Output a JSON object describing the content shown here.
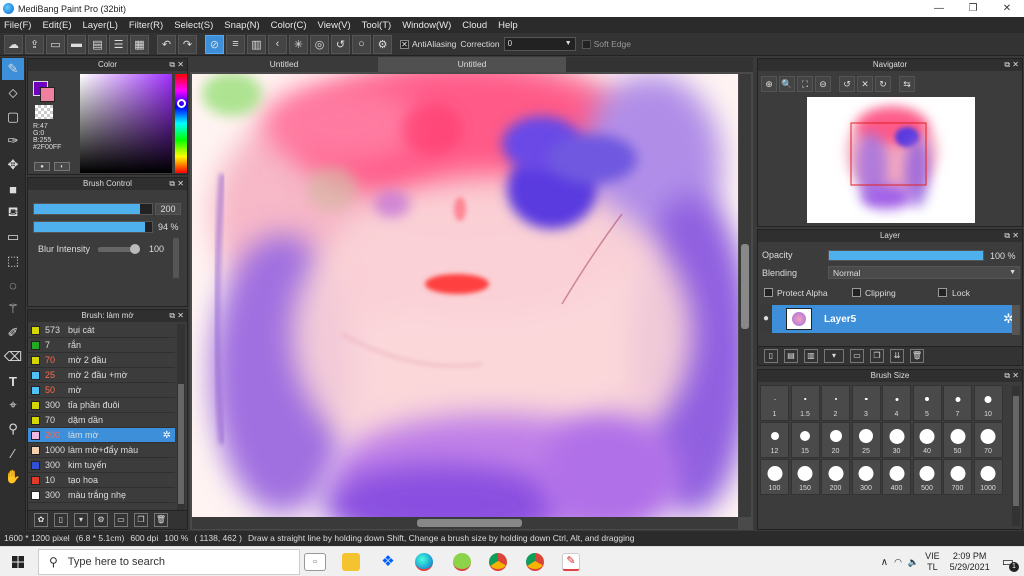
{
  "window": {
    "title": "MediBang Paint Pro (32bit)",
    "min": "—",
    "max": "❐",
    "close": "✕"
  },
  "menu": [
    "File(F)",
    "Edit(E)",
    "Layer(L)",
    "Filter(R)",
    "Select(S)",
    "Snap(N)",
    "Color(C)",
    "View(V)",
    "Tool(T)",
    "Window(W)",
    "Cloud",
    "Help"
  ],
  "toolbar": {
    "antialias_label": "AntiAliasing",
    "antialias_checked": "✕",
    "correction_label": "Correction",
    "correction_value": "0",
    "softedge_label": "Soft Edge"
  },
  "color_panel": {
    "title": "Color",
    "fg_color": "#2F00FF",
    "r": "R:47",
    "g": "G:0",
    "b": "B:255",
    "hex": "#2F00FF"
  },
  "brush_control": {
    "title": "Brush Control",
    "size": "200",
    "size_fraction": 0.9,
    "opacity": "94 %",
    "opacity_fraction": 0.94,
    "blur_label": "Blur Intensity",
    "blur_value": "100",
    "blur_fraction": 1.0
  },
  "brush_list": {
    "title": "Brush: làm mờ",
    "items": [
      {
        "size": "573",
        "name": "bụi cát",
        "color": "#d6d600",
        "sel": false,
        "size_color": "#ddd"
      },
      {
        "size": "7",
        "name": "rắn",
        "color": "#22aa22",
        "sel": false,
        "size_color": "#ddd"
      },
      {
        "size": "70",
        "name": "mờ 2 đầu",
        "color": "#d6d600",
        "sel": false,
        "size_color": "#ff6a4d"
      },
      {
        "size": "25",
        "name": "mờ 2 đầu +mờ",
        "color": "#4fc3f7",
        "sel": false,
        "size_color": "#ff6a4d"
      },
      {
        "size": "50",
        "name": "mờ",
        "color": "#4fc3f7",
        "sel": false,
        "size_color": "#ff6a4d"
      },
      {
        "size": "300",
        "name": "tỉa phần đuôi",
        "color": "#d6d600",
        "sel": false,
        "size_color": "#ddd"
      },
      {
        "size": "70",
        "name": "dặm dần",
        "color": "#d6d600",
        "sel": false,
        "size_color": "#ddd"
      },
      {
        "size": "200",
        "name": "làm mờ",
        "color": "#f0b8e0",
        "sel": true,
        "size_color": "#ff6a4d"
      },
      {
        "size": "1000",
        "name": "làm mờ+đẩy màu",
        "color": "#f3d0b0",
        "sel": false,
        "size_color": "#ddd"
      },
      {
        "size": "300",
        "name": "kim tuyến",
        "color": "#3050d8",
        "sel": false,
        "size_color": "#ddd"
      },
      {
        "size": "10",
        "name": "tạo hoa",
        "color": "#e03a2a",
        "sel": false,
        "size_color": "#ddd"
      },
      {
        "size": "300",
        "name": "màu trắng nhẹ",
        "color": "#ffffff",
        "sel": false,
        "size_color": "#ddd"
      }
    ]
  },
  "canvas": {
    "tabs": [
      "Untitled",
      "Untitled"
    ],
    "active_tab": 1
  },
  "navigator": {
    "title": "Navigator"
  },
  "layer_panel": {
    "title": "Layer",
    "opacity_label": "Opacity",
    "opacity_value": "100 %",
    "opacity_fraction": 1.0,
    "blending_label": "Blending",
    "blending_value": "Normal",
    "protect_alpha": "Protect Alpha",
    "clipping": "Clipping",
    "lock": "Lock",
    "layer_name": "Layer5"
  },
  "brush_size": {
    "title": "Brush Size",
    "sizes": [
      "1",
      "1.5",
      "2",
      "3",
      "4",
      "5",
      "7",
      "10",
      "12",
      "15",
      "20",
      "25",
      "30",
      "40",
      "50",
      "70",
      "100",
      "150",
      "200",
      "300",
      "400",
      "500",
      "700",
      "1000"
    ]
  },
  "status": {
    "size": "1600 * 1200 pixel",
    "physical": "(6.8 * 5.1cm)",
    "dpi": "600 dpi",
    "zoom": "100 %",
    "coords": "( 1138, 462 )",
    "hint": "Draw a straight line by holding down Shift, Change a brush size by holding down Ctrl, Alt, and dragging"
  },
  "taskbar": {
    "search_placeholder": "Type here to search",
    "lang_top": "VIE",
    "lang_bottom": "TL",
    "time": "2:09 PM",
    "date": "5/29/2021",
    "notif_count": "1"
  }
}
